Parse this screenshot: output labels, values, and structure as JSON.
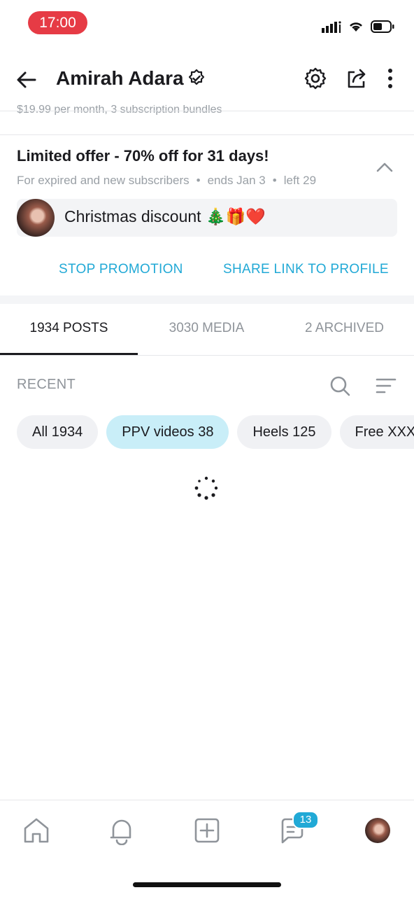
{
  "status_bar": {
    "time": "17:00"
  },
  "header": {
    "title": "Amirah Adara",
    "icons": [
      "back-arrow-icon",
      "verified-icon",
      "settings-icon",
      "share-icon",
      "more-vertical-icon"
    ]
  },
  "subscription_line": "$19.99 per month, 3 subscription bundles",
  "promotion": {
    "title": "Limited offer - 70% off for 31 days!",
    "audience": "For expired and new subscribers",
    "ends": "ends Jan 3",
    "left": "left 29",
    "message": "Christmas discount 🎄🎁❤️",
    "stop_label": "STOP PROMOTION",
    "share_label": "SHARE LINK TO PROFILE"
  },
  "tabs": [
    {
      "label": "1934 POSTS",
      "active": true
    },
    {
      "label": "3030 MEDIA",
      "active": false
    },
    {
      "label": "2 ARCHIVED",
      "active": false
    }
  ],
  "filter": {
    "label": "RECENT",
    "chips": [
      {
        "label": "All 1934",
        "selected": false
      },
      {
        "label": "PPV videos 38",
        "selected": true
      },
      {
        "label": "Heels 125",
        "selected": false
      },
      {
        "label": "Free XXX",
        "selected": false
      }
    ]
  },
  "bottom_nav": {
    "items": [
      "home-icon",
      "notifications-icon",
      "add-post-icon",
      "messages-icon",
      "profile-avatar"
    ],
    "messages_badge": "13"
  },
  "colors": {
    "accent": "#21a9d6",
    "time_pill": "#e63b45",
    "chip_selected": "#c9eef8"
  }
}
